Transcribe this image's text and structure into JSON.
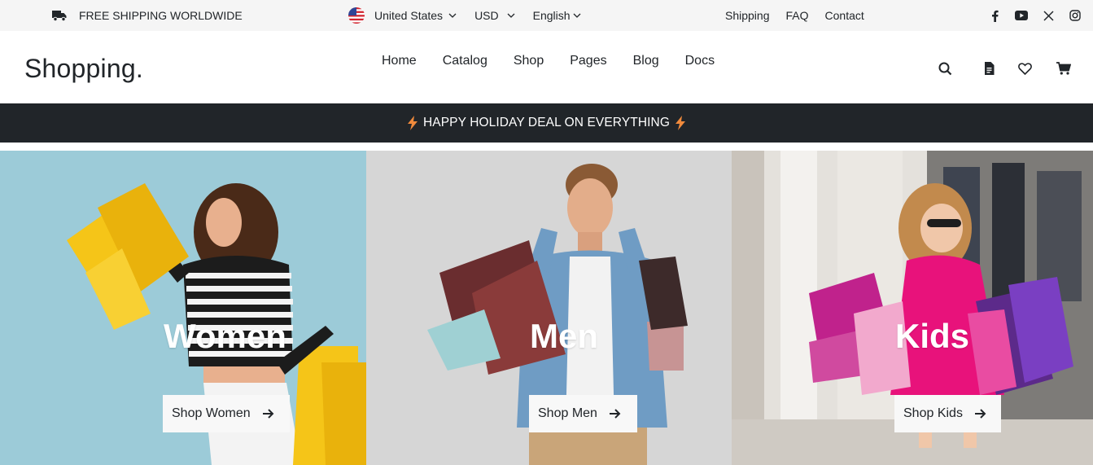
{
  "topbar": {
    "shipping_notice": "FREE SHIPPING WORLDWIDE",
    "country": "United States",
    "currency": "USD",
    "language": "English",
    "links": [
      "Shipping",
      "FAQ",
      "Contact"
    ],
    "socials": [
      "facebook-icon",
      "youtube-icon",
      "x-icon",
      "instagram-icon"
    ]
  },
  "header": {
    "logo": "Shopping.",
    "nav": [
      "Home",
      "Catalog",
      "Shop",
      "Pages",
      "Blog",
      "Docs"
    ],
    "icons": [
      "search-icon",
      "document-icon",
      "heart-icon",
      "cart-icon"
    ]
  },
  "announcement": {
    "text": "HAPPY HOLIDAY DEAL ON EVERYTHING",
    "accent": "#f08a3c"
  },
  "hero": {
    "women": {
      "title": "Women",
      "button": "Shop Women",
      "bg": "#9ccbd8"
    },
    "men": {
      "title": "Men",
      "button": "Shop Men",
      "bg": "#d6d6d6"
    },
    "kids": {
      "title": "Kids",
      "button": "Shop Kids",
      "bg": "#e4e1dc"
    }
  },
  "colors": {
    "dark": "#212529",
    "topbar_bg": "#f5f5f5"
  }
}
